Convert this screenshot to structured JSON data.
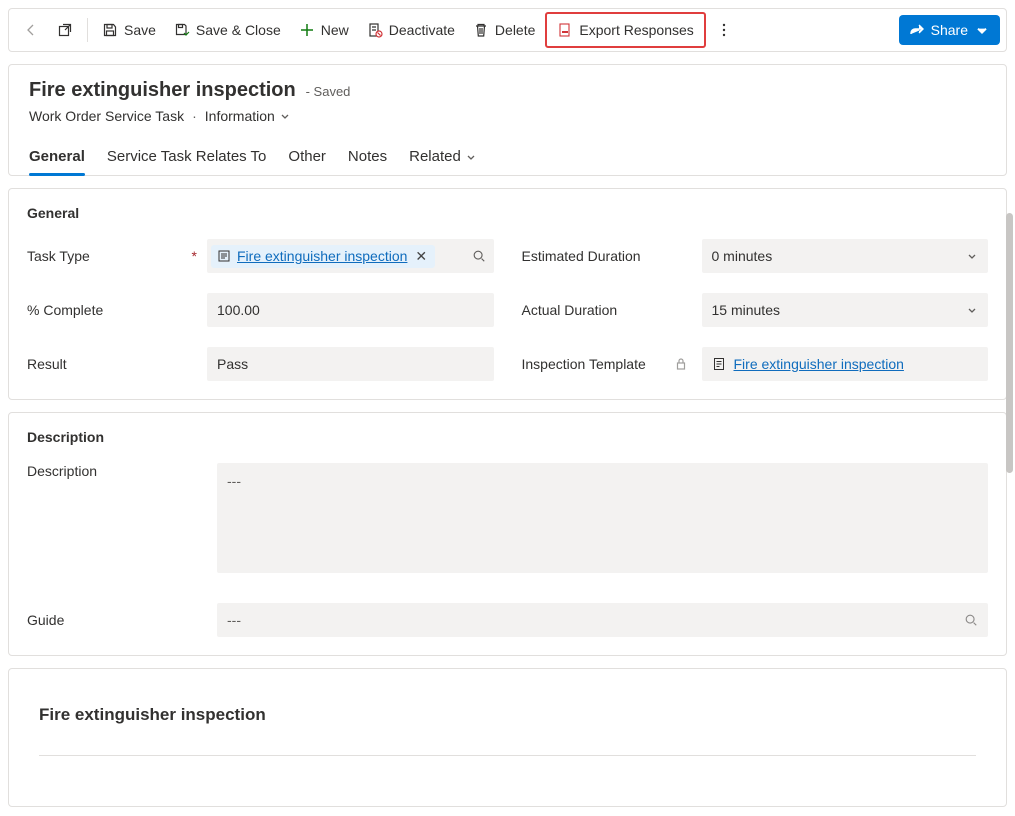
{
  "commands": {
    "save": "Save",
    "save_close": "Save & Close",
    "new": "New",
    "deactivate": "Deactivate",
    "delete": "Delete",
    "export_responses": "Export Responses",
    "share": "Share"
  },
  "header": {
    "title": "Fire extinguisher inspection",
    "save_state": "- Saved",
    "entity": "Work Order Service Task",
    "form_name": "Information"
  },
  "tabs": {
    "general": "General",
    "relates": "Service Task Relates To",
    "other": "Other",
    "notes": "Notes",
    "related": "Related"
  },
  "sections": {
    "general_title": "General",
    "description_title": "Description"
  },
  "fields": {
    "task_type_label": "Task Type",
    "task_type_value": "Fire extinguisher inspection",
    "pct_complete_label": "% Complete",
    "pct_complete_value": "100.00",
    "result_label": "Result",
    "result_value": "Pass",
    "est_duration_label": "Estimated Duration",
    "est_duration_value": "0 minutes",
    "act_duration_label": "Actual Duration",
    "act_duration_value": "15 minutes",
    "insp_template_label": "Inspection Template",
    "insp_template_value": "Fire extinguisher inspection",
    "description_label": "Description",
    "description_value": "---",
    "guide_label": "Guide",
    "guide_value": "---"
  },
  "bottom": {
    "title": "Fire extinguisher inspection"
  }
}
